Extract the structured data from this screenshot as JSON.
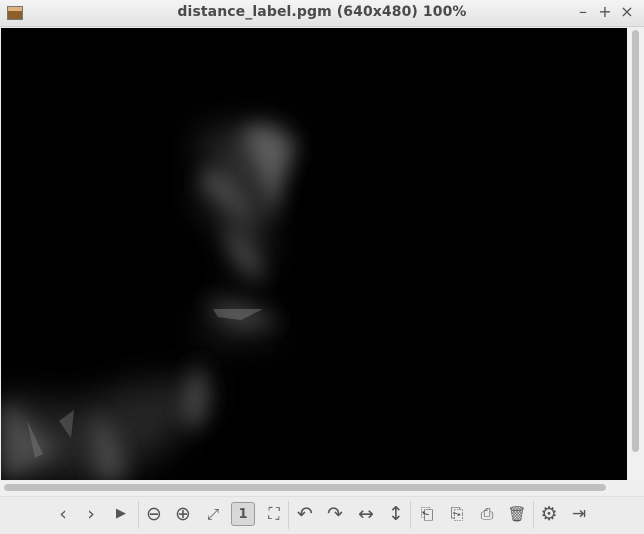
{
  "window": {
    "title": "distance_label.pgm (640x480) 100%",
    "controls": {
      "minimize": "–",
      "maximize": "+",
      "close": "×"
    }
  },
  "toolbar": {
    "prev": "‹",
    "next": "›",
    "play": "▶",
    "zoom_out": "⊖",
    "zoom_in": "⊕",
    "fit": "⤢",
    "original": "1",
    "fullscreen": "⛶",
    "rotate_ccw": "↶",
    "rotate_cw": "↷",
    "flip_h": "↔",
    "flip_v": "↕",
    "open": "⎗",
    "save": "⎘",
    "save_as": "⎙",
    "delete": "🗑",
    "settings": "⚙",
    "exit": "⇥"
  },
  "colors": {
    "accent": "#555555",
    "background": "#000000"
  }
}
